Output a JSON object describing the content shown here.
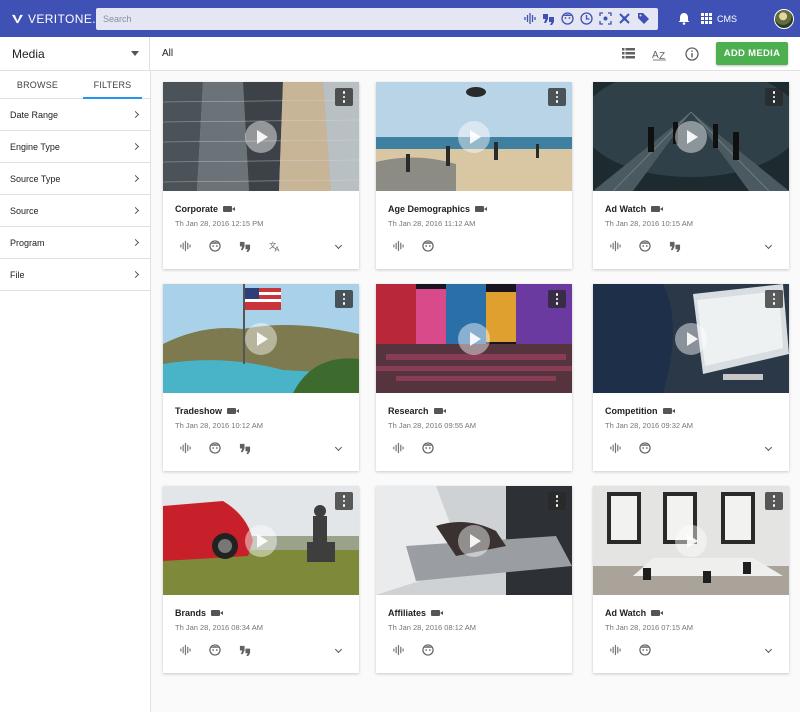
{
  "brand": {
    "name": "VERITONE."
  },
  "search": {
    "placeholder": "Search",
    "tools": [
      "waveform-icon",
      "transcript-icon",
      "face-icon",
      "sentiment-icon",
      "object-icon",
      "logo-icon",
      "tag-icon"
    ]
  },
  "topbar": {
    "app_label": "CMS",
    "icons": [
      "bell-icon",
      "apps-grid-icon",
      "avatar"
    ]
  },
  "subbar": {
    "media_select": "Media",
    "filter_label": "All",
    "icons": [
      "list-view-icon",
      "sort-az-icon",
      "info-icon"
    ],
    "add_button": "ADD MEDIA"
  },
  "sidebar": {
    "tabs": [
      {
        "label": "BROWSE",
        "active": false
      },
      {
        "label": "FILTERS",
        "active": true
      }
    ],
    "filters": [
      "Date Range",
      "Engine Type",
      "Source Type",
      "Source",
      "Program",
      "File"
    ]
  },
  "cards": [
    {
      "title": "Corporate",
      "date": "Th Jan 28, 2016 12:15 PM",
      "engines": [
        "waveform",
        "face",
        "transcript",
        "translate"
      ],
      "expandable": true
    },
    {
      "title": "Age Demographics",
      "date": "Th Jan 28, 2016 11:12 AM",
      "engines": [
        "waveform",
        "face"
      ],
      "expandable": false
    },
    {
      "title": "Ad Watch",
      "date": "Th Jan 28, 2016 10:15 AM",
      "engines": [
        "waveform",
        "face",
        "transcript"
      ],
      "expandable": true
    },
    {
      "title": "Tradeshow",
      "date": "Th Jan 28, 2016 10:12 AM",
      "engines": [
        "waveform",
        "face",
        "transcript"
      ],
      "expandable": true
    },
    {
      "title": "Research",
      "date": "Th Jan 28, 2016 09:55 AM",
      "engines": [
        "waveform",
        "face"
      ],
      "expandable": false
    },
    {
      "title": "Competition",
      "date": "Th Jan 28, 2016 09:32 AM",
      "engines": [
        "waveform",
        "face"
      ],
      "expandable": true
    },
    {
      "title": "Brands",
      "date": "Th Jan 28, 2016 08:34 AM",
      "engines": [
        "waveform",
        "face",
        "transcript"
      ],
      "expandable": true
    },
    {
      "title": "Affiliates",
      "date": "Th Jan 28, 2016 08:12 AM",
      "engines": [
        "waveform",
        "face"
      ],
      "expandable": false
    },
    {
      "title": "Ad Watch",
      "date": "Th Jan 28, 2016 07:15 AM",
      "engines": [
        "waveform",
        "face"
      ],
      "expandable": true
    }
  ],
  "colors": {
    "header": "#3f51b5",
    "accent_tab": "#2196f3",
    "add_button": "#4caf50"
  }
}
